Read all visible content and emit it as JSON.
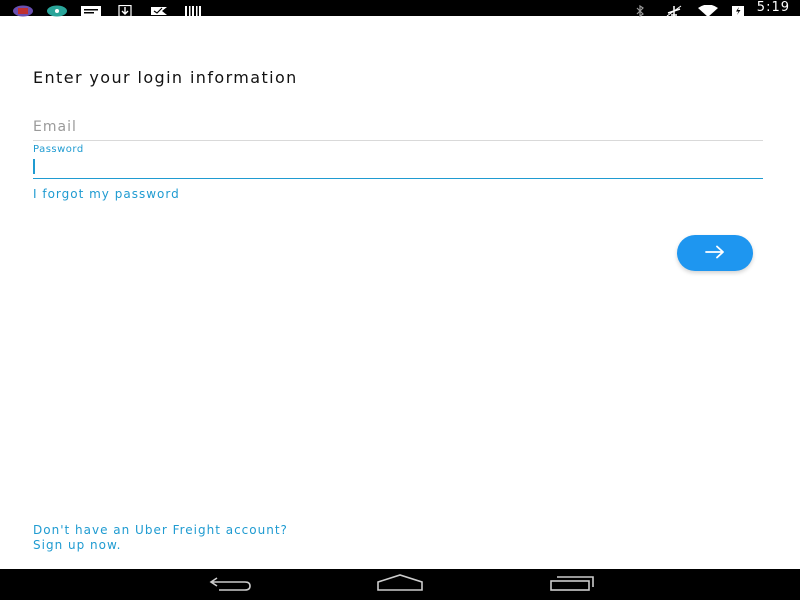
{
  "status_bar": {
    "left_icons": [
      "app-icon-1",
      "app-icon-2",
      "message-icon",
      "download-icon",
      "checkmark-flag-icon",
      "barcode-icon"
    ],
    "right_icons": [
      "bluetooth-icon",
      "airplane-mode-icon",
      "wifi-icon",
      "battery-charging-icon"
    ],
    "time": "5:19"
  },
  "login": {
    "title": "Enter your login information",
    "email_placeholder": "Email",
    "password_label": "Password",
    "forgot_password": "I forgot my password",
    "next_icon": "arrow-right-icon"
  },
  "footer": {
    "line1": "Don't have an Uber Freight account?",
    "line2": "Sign up now."
  },
  "nav_bar": {
    "buttons": [
      "back-icon",
      "home-icon",
      "recents-icon"
    ]
  },
  "colors": {
    "accent": "#1f9bd1",
    "button": "#1e96f0"
  }
}
